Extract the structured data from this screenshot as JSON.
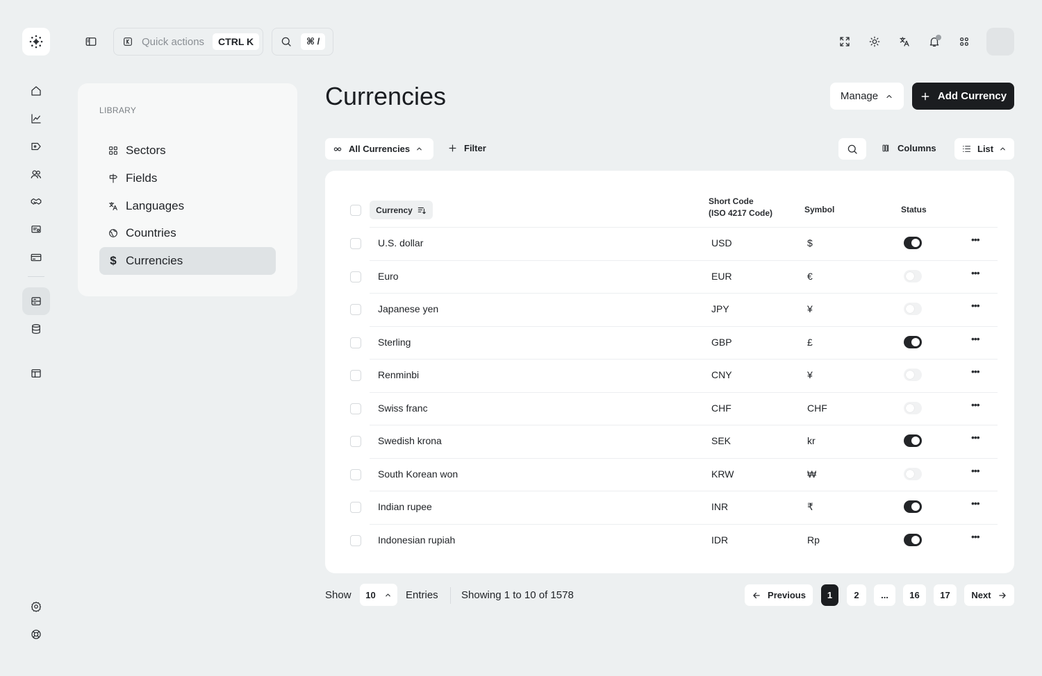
{
  "topbar": {
    "quick_actions_placeholder": "Quick actions",
    "quick_actions_shortcut": "CTRL K",
    "search_shortcut": "⌘ /"
  },
  "library": {
    "title": "LIBRARY",
    "items": [
      {
        "label": "Sectors",
        "icon": "grid-icon"
      },
      {
        "label": "Fields",
        "icon": "signpost-icon"
      },
      {
        "label": "Languages",
        "icon": "translate-icon"
      },
      {
        "label": "Countries",
        "icon": "globe-icon"
      },
      {
        "label": "Currencies",
        "icon": "dollar-icon",
        "active": true
      }
    ]
  },
  "page": {
    "title": "Currencies",
    "manage_label": "Manage",
    "add_label": "Add Currency"
  },
  "toolbar": {
    "view_label": "All Currencies",
    "filter_label": "Filter",
    "columns_label": "Columns",
    "layout_label": "List"
  },
  "table": {
    "headers": {
      "currency": "Currency",
      "short_code_1": "Short Code",
      "short_code_2": "(ISO 4217 Code)",
      "symbol": "Symbol",
      "status": "Status"
    },
    "rows": [
      {
        "name": "U.S. dollar",
        "code": "USD",
        "symbol": "$",
        "active": true
      },
      {
        "name": "Euro",
        "code": "EUR",
        "symbol": "€",
        "active": false
      },
      {
        "name": "Japanese yen",
        "code": "JPY",
        "symbol": "¥",
        "active": false
      },
      {
        "name": "Sterling",
        "code": "GBP",
        "symbol": "£",
        "active": true
      },
      {
        "name": "Renminbi",
        "code": "CNY",
        "symbol": "¥",
        "active": false
      },
      {
        "name": "Swiss franc",
        "code": "CHF",
        "symbol": "CHF",
        "active": false
      },
      {
        "name": "Swedish krona",
        "code": "SEK",
        "symbol": "kr",
        "active": true
      },
      {
        "name": "South Korean won",
        "code": "KRW",
        "symbol": "₩",
        "active": false
      },
      {
        "name": "Indian rupee",
        "code": "INR",
        "symbol": "₹",
        "active": true
      },
      {
        "name": "Indonesian rupiah",
        "code": "IDR",
        "symbol": "Rp",
        "active": true
      }
    ]
  },
  "footer": {
    "show_label": "Show",
    "page_size": "10",
    "entries_label": "Entries",
    "showing_text": "Showing 1 to 10 of 1578",
    "previous_label": "Previous",
    "next_label": "Next",
    "pages": [
      "1",
      "2",
      "...",
      "16",
      "17"
    ],
    "current_page": "1"
  },
  "colors": {
    "background": "#edf0f1",
    "accent_dark": "#1b1d20",
    "card": "#ffffff"
  }
}
